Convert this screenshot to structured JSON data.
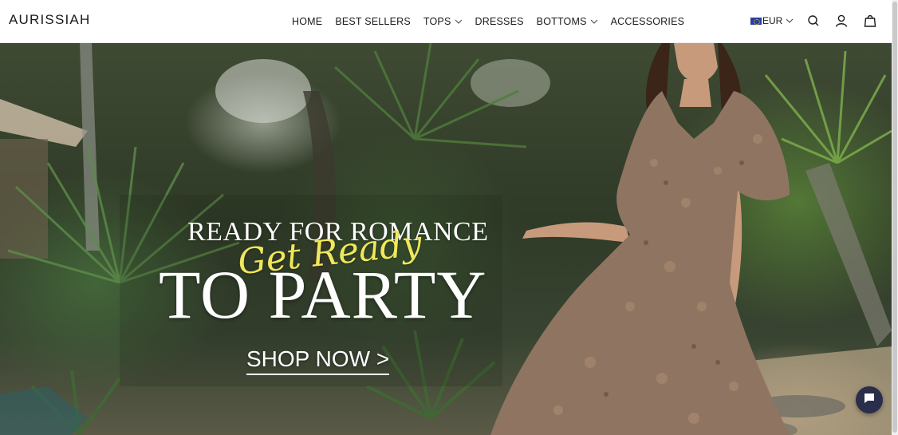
{
  "brand": {
    "logo": "AURISSIAH"
  },
  "nav": {
    "items": [
      {
        "label": "HOME",
        "dropdown": false
      },
      {
        "label": "BEST SELLERS",
        "dropdown": false
      },
      {
        "label": "TOPS",
        "dropdown": true
      },
      {
        "label": "DRESSES",
        "dropdown": false
      },
      {
        "label": "BOTTOMS",
        "dropdown": true
      },
      {
        "label": "ACCESSORIES",
        "dropdown": false
      }
    ]
  },
  "header_actions": {
    "currency": "EUR",
    "icons": [
      "search-icon",
      "account-icon",
      "cart-icon"
    ]
  },
  "hero": {
    "headline_top": "READY FOR ROMANCE",
    "script_text": "Get Ready",
    "headline_main": "TO PARTY",
    "cta": "SHOP NOW >"
  },
  "chat": {
    "icon": "chat-icon"
  },
  "colors": {
    "header_bg": "#ffffff",
    "text": "#1a1a1a",
    "script_yellow": "#f0e85a",
    "chat_bg": "#2b2e4a",
    "flag_blue": "#2a3f9d"
  }
}
